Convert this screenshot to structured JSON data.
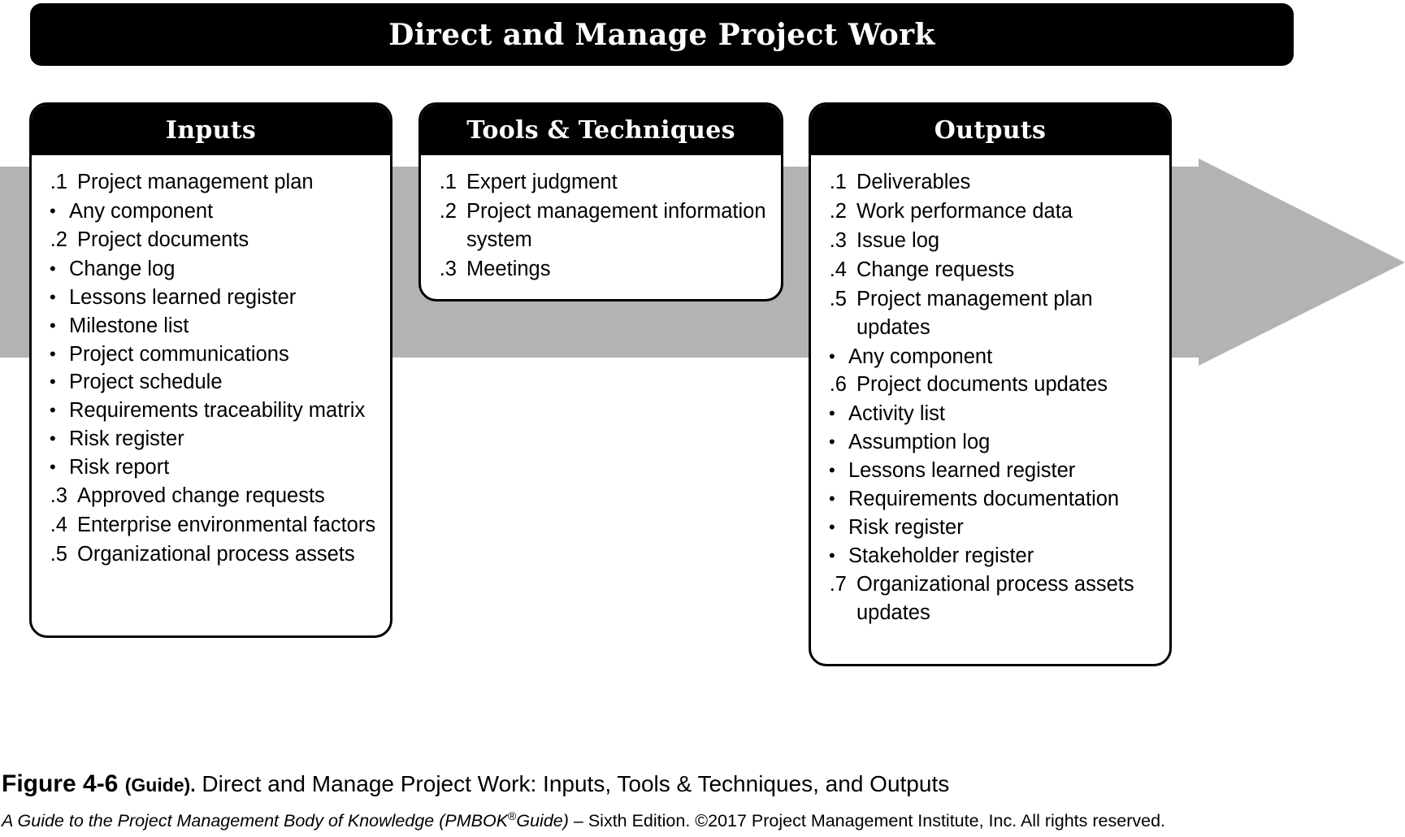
{
  "figure": {
    "title": "Direct and Manage Project Work",
    "colors": {
      "header_bg": "#000000",
      "header_text": "#ffffff",
      "box_border": "#000000",
      "arrow_gray": "#b3b3b3",
      "page_bg": "#ffffff"
    }
  },
  "columns": [
    {
      "id": "inputs",
      "header": "Inputs",
      "items": [
        {
          "num": ".1",
          "text": "Project management plan",
          "sub": [
            "Any component"
          ]
        },
        {
          "num": ".2",
          "text": "Project documents",
          "sub": [
            "Change log",
            "Lessons learned register",
            "Milestone list",
            "Project communications",
            "Project schedule",
            "Requirements traceability matrix",
            "Risk register",
            "Risk report"
          ]
        },
        {
          "num": ".3",
          "text": "Approved change requests",
          "sub": []
        },
        {
          "num": ".4",
          "text": "Enterprise environmental factors",
          "sub": []
        },
        {
          "num": ".5",
          "text": "Organizational process assets",
          "sub": []
        }
      ]
    },
    {
      "id": "tools",
      "header": "Tools & Techniques",
      "items": [
        {
          "num": ".1",
          "text": "Expert judgment",
          "sub": []
        },
        {
          "num": ".2",
          "text": "Project management information system",
          "sub": []
        },
        {
          "num": ".3",
          "text": "Meetings",
          "sub": []
        }
      ]
    },
    {
      "id": "outputs",
      "header": "Outputs",
      "items": [
        {
          "num": ".1",
          "text": "Deliverables",
          "sub": []
        },
        {
          "num": ".2",
          "text": "Work performance data",
          "sub": []
        },
        {
          "num": ".3",
          "text": "Issue log",
          "sub": []
        },
        {
          "num": ".4",
          "text": "Change requests",
          "sub": []
        },
        {
          "num": ".5",
          "text": "Project management plan updates",
          "sub": [
            "Any component"
          ]
        },
        {
          "num": ".6",
          "text": "Project documents updates",
          "sub": [
            "Activity list",
            "Assumption log",
            "Lessons learned register",
            "Requirements documentation",
            "Risk register",
            "Stakeholder register"
          ]
        },
        {
          "num": ".7",
          "text": "Organizational process assets updates",
          "sub": []
        }
      ]
    }
  ],
  "caption": {
    "figure_label": "Figure 4-6",
    "guide_label": "(Guide).",
    "description": "Direct and Manage Project Work: Inputs, Tools & Techniques, and Outputs"
  },
  "source": {
    "italic_part": "A Guide to the Project Management Body of Knowledge (PMBOK",
    "registered_mark": "®",
    "italic_part2": "Guide)",
    "rest": " – Sixth Edition. ©2017 Project Management Institute, Inc. All rights reserved."
  },
  "bullet_glyph": "•"
}
